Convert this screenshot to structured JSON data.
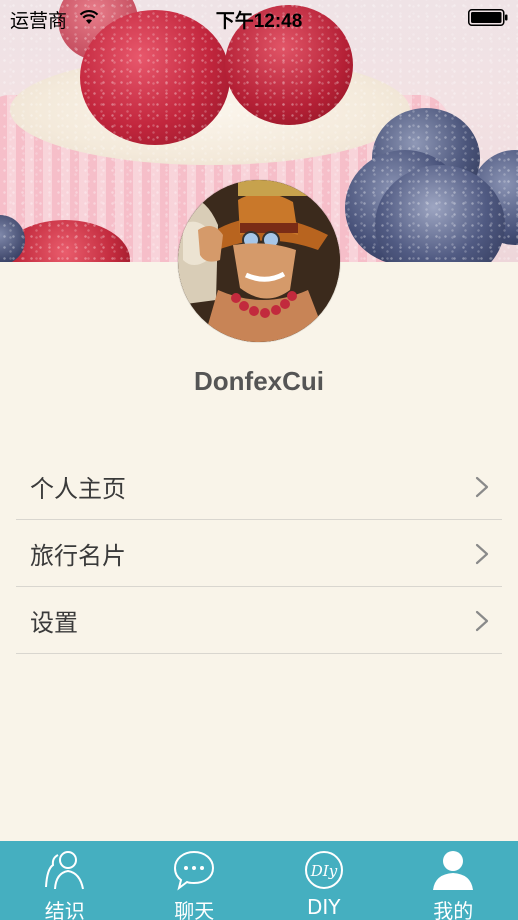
{
  "status_bar": {
    "carrier": "运营商",
    "time": "下午12:48"
  },
  "profile": {
    "username": "DonfexCui"
  },
  "menu": {
    "items": [
      {
        "label": "个人主页"
      },
      {
        "label": "旅行名片"
      },
      {
        "label": "设置"
      }
    ]
  },
  "tabbar": {
    "tabs": [
      {
        "label": "结识",
        "icon": "people-icon"
      },
      {
        "label": "聊天",
        "icon": "chat-bubble-icon"
      },
      {
        "label": "DIY",
        "icon": "diy-icon",
        "icon_text": "DIy"
      },
      {
        "label": "我的",
        "icon": "user-icon",
        "selected": true
      }
    ]
  },
  "colors": {
    "background": "#f9f4e9",
    "tabbar": "#45afc0",
    "divider": "#d9d6cf",
    "username": "#555555"
  }
}
